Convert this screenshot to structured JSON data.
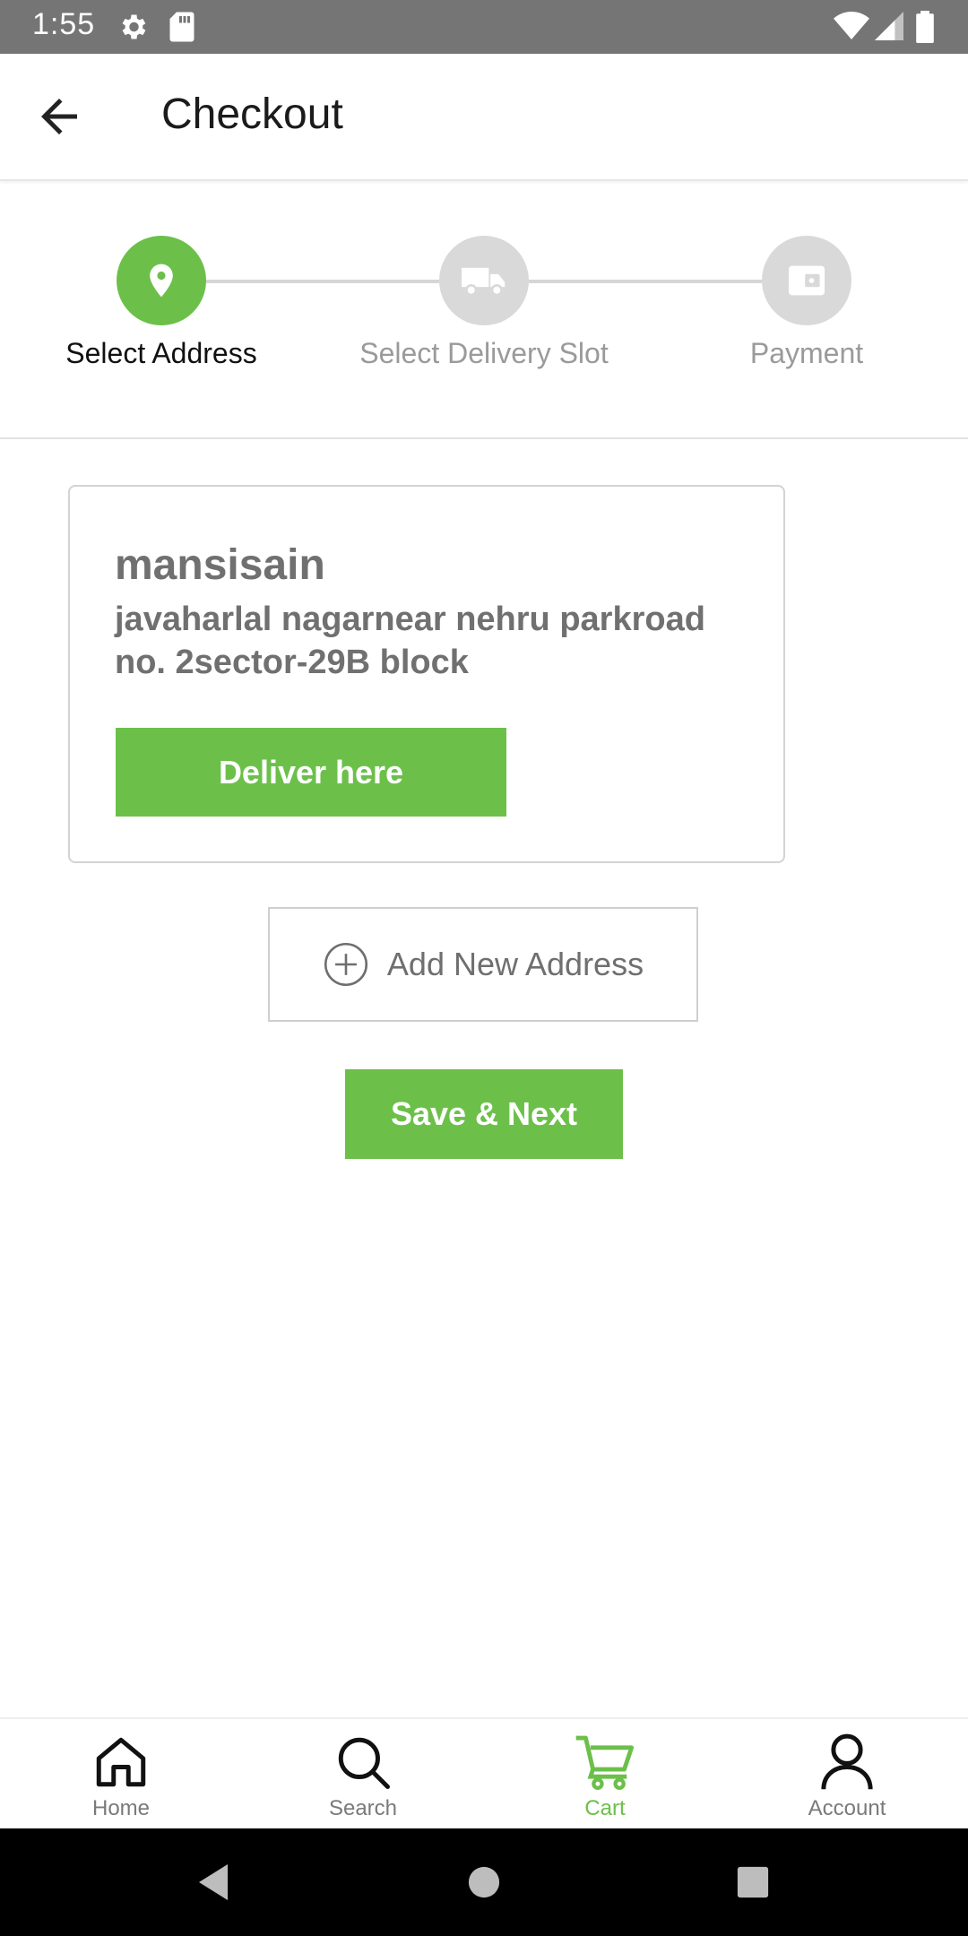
{
  "status_bar": {
    "time": "1:55",
    "icons": [
      "settings-icon",
      "sd-card-icon",
      "wifi-icon",
      "signal-icon",
      "battery-icon"
    ]
  },
  "app_bar": {
    "title": "Checkout",
    "back_icon": "arrow-left-icon"
  },
  "stepper": {
    "steps": [
      {
        "label": "Select Address",
        "icon": "location-pin-icon",
        "active": true
      },
      {
        "label": "Select Delivery Slot",
        "icon": "truck-icon",
        "active": false
      },
      {
        "label": "Payment",
        "icon": "wallet-icon",
        "active": false
      }
    ]
  },
  "address_card": {
    "name": "mansisain",
    "address": "javaharlal nagarnear nehru parkroad no. 2sector-29B block",
    "deliver_button": "Deliver here"
  },
  "add_address": {
    "label": "Add New Address",
    "icon": "plus-circle-icon"
  },
  "save_button": "Save & Next",
  "bottom_nav": {
    "items": [
      {
        "label": "Home",
        "icon": "home-icon",
        "active": false
      },
      {
        "label": "Search",
        "icon": "search-icon",
        "active": false
      },
      {
        "label": "Cart",
        "icon": "cart-icon",
        "active": true
      },
      {
        "label": "Account",
        "icon": "account-icon",
        "active": false
      }
    ]
  },
  "colors": {
    "accent": "#6cc04a",
    "status_bar": "#757575",
    "inactive_step": "#d9d9d9",
    "muted_text": "#707070"
  }
}
